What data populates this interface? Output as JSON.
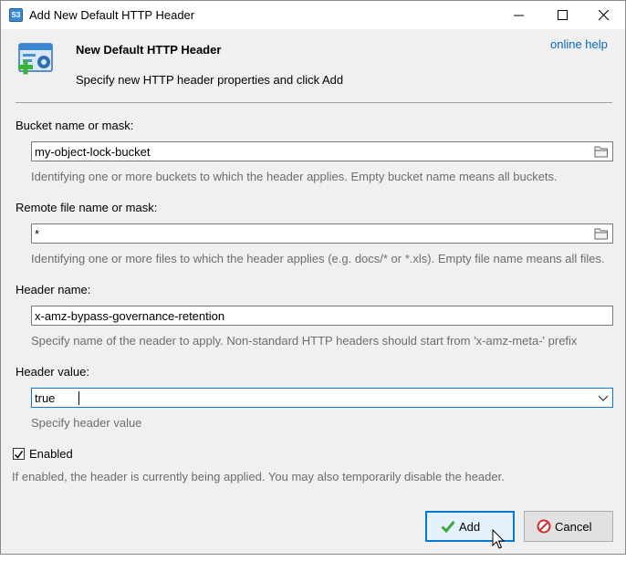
{
  "window": {
    "title": "Add New Default HTTP Header",
    "app_icon_text": "S3"
  },
  "header": {
    "title": "New Default HTTP Header",
    "subtitle": "Specify new HTTP header properties and click Add",
    "help_link": "online help"
  },
  "fields": {
    "bucket": {
      "label": "Bucket name or mask:",
      "value": "my-object-lock-bucket",
      "hint": "Identifying one or more buckets to which the header applies. Empty bucket name means all buckets."
    },
    "remote_file": {
      "label": "Remote file name or mask:",
      "value": "*",
      "hint": "Identifying one or more files to which the header applies (e.g. docs/* or *.xls). Empty file name means all files."
    },
    "header_name": {
      "label": "Header name:",
      "value": "x-amz-bypass-governance-retention",
      "hint": "Specify name of the neader to apply. Non-standard HTTP headers should start from 'x-amz-meta-' prefix"
    },
    "header_value": {
      "label": "Header value:",
      "value": "true",
      "hint": "Specify header value"
    }
  },
  "enabled": {
    "label": "Enabled",
    "checked": true,
    "hint": "If enabled, the header is currently being applied. You may also temporarily disable the header."
  },
  "buttons": {
    "add": "Add",
    "cancel": "Cancel"
  },
  "colors": {
    "link": "#0a66c2",
    "focus_border": "#0078d7",
    "hint_text": "#6d6d6d",
    "dialog_bg": "#f0f0f0"
  }
}
